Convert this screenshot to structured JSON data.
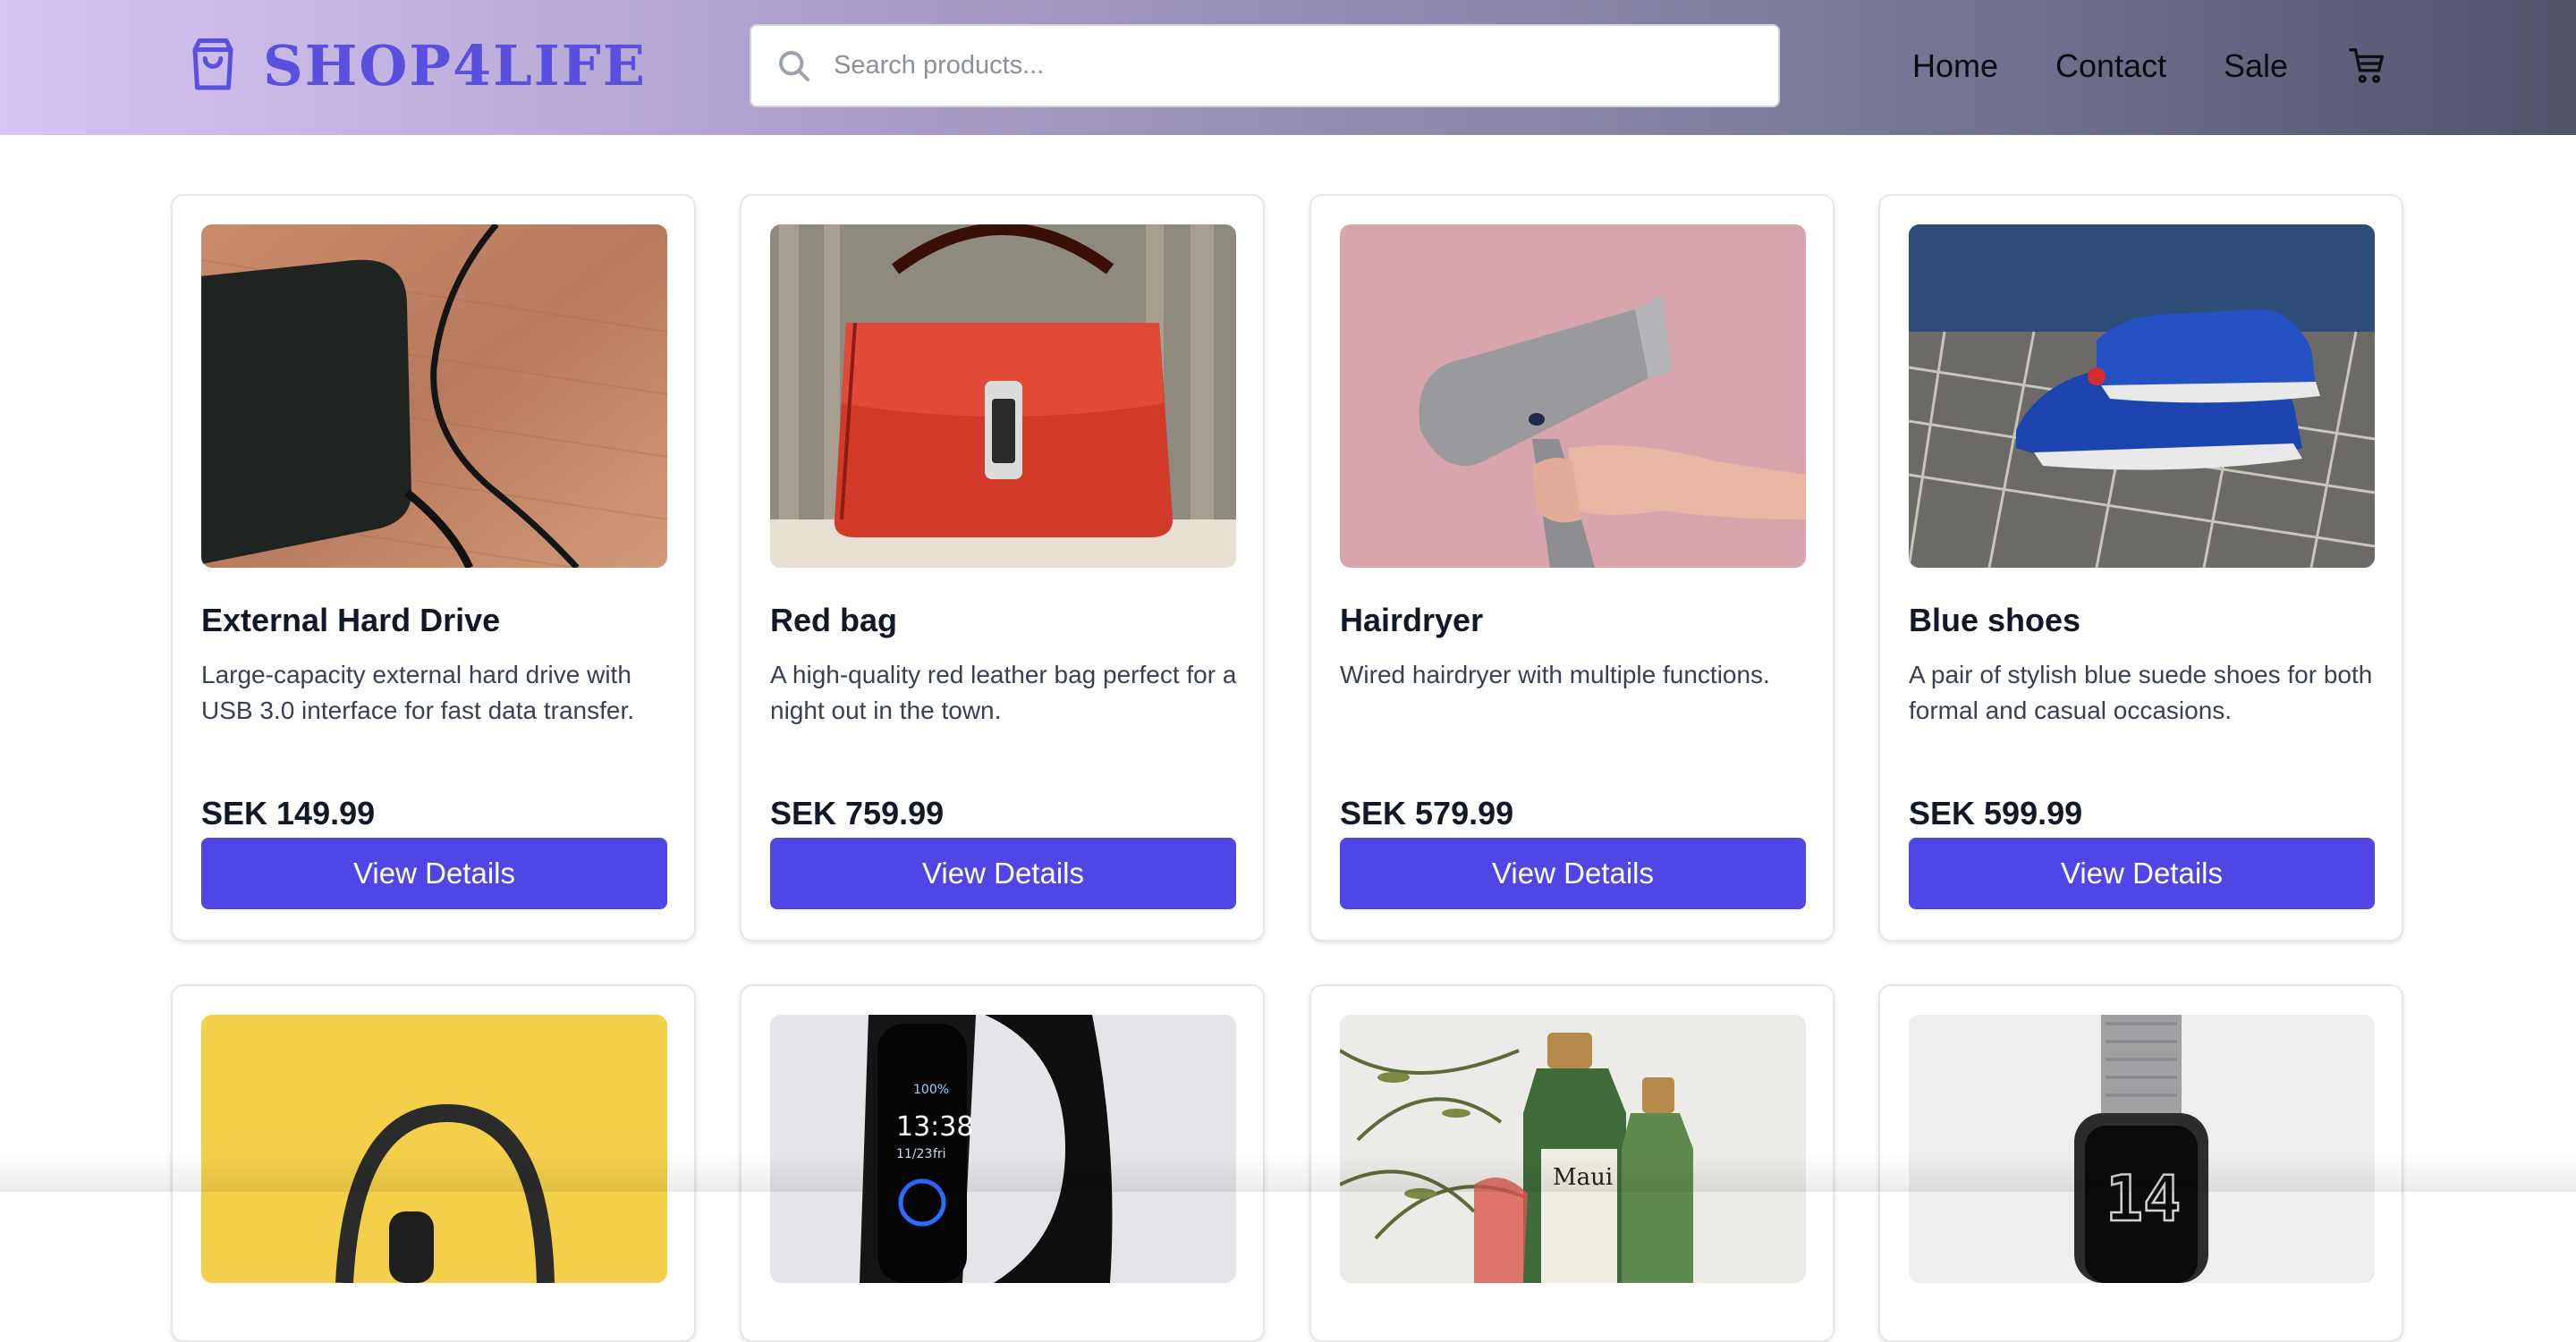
{
  "brand": {
    "name": "SHOP4LIFE",
    "color": "#5b4fe0"
  },
  "search": {
    "placeholder": "Search products..."
  },
  "nav": {
    "items": [
      "Home",
      "Contact",
      "Sale"
    ],
    "cart_icon": "cart-icon"
  },
  "colors": {
    "accent": "#4f46e5",
    "header_start": "#d7c5f4",
    "header_end": "#51536b"
  },
  "products": [
    {
      "name": "External Hard Drive",
      "description": "Large-capacity external hard drive with USB 3.0 interface for fast data transfer.",
      "price": "SEK 149.99",
      "button": "View Details",
      "image": "external-hard-drive-photo"
    },
    {
      "name": "Red bag",
      "description": "A high-quality red leather bag perfect for a night out in the town.",
      "price": "SEK 759.99",
      "button": "View Details",
      "image": "red-bag-photo"
    },
    {
      "name": "Hairdryer",
      "description": "Wired hairdryer with multiple functions.",
      "price": "SEK 579.99",
      "button": "View Details",
      "image": "hairdryer-photo"
    },
    {
      "name": "Blue shoes",
      "description": "A pair of stylish blue suede shoes for both formal and casual occasions.",
      "price": "SEK 599.99",
      "button": "View Details",
      "image": "blue-shoes-photo"
    }
  ],
  "products_row2": [
    {
      "image": "headphones-photo"
    },
    {
      "image": "fitness-band-photo",
      "screen_text": [
        "100%",
        "13:38",
        "11/23",
        "fri"
      ]
    },
    {
      "image": "cosmetic-bottles-photo",
      "label_text": "Maui"
    },
    {
      "image": "smartwatch-photo",
      "screen_text": "14"
    }
  ]
}
